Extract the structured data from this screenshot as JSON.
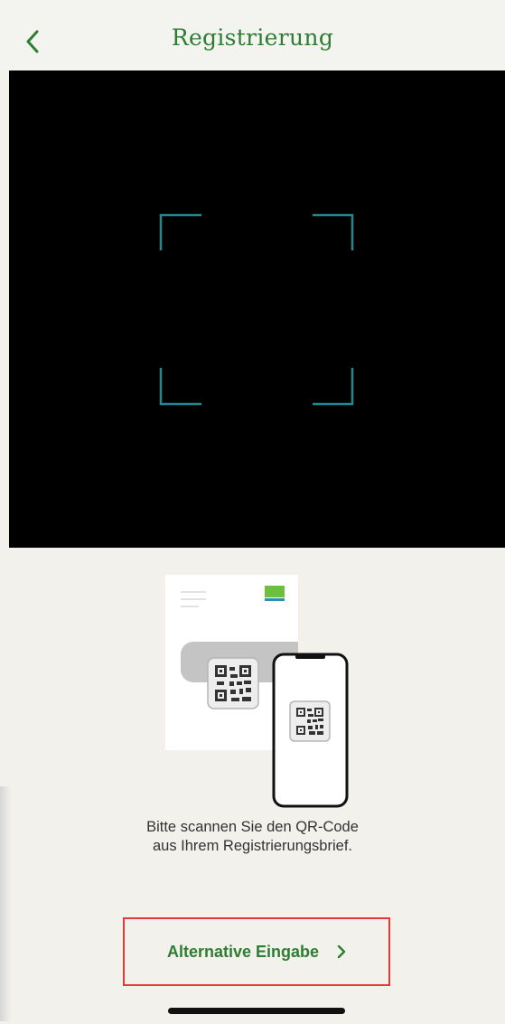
{
  "header": {
    "title": "Registrierung"
  },
  "icons": {
    "back": "chevron-left-icon",
    "forward": "chevron-right-icon"
  },
  "instructions": {
    "line1": "Bitte scannen Sie den QR-Code",
    "line2": "aus Ihrem Registrierungsbrief."
  },
  "alternative": {
    "label": "Alternative Eingabe"
  },
  "colors": {
    "accent_green": "#2e7d32",
    "scan_frame": "#1f8a8f",
    "highlight_red": "#e53935"
  }
}
